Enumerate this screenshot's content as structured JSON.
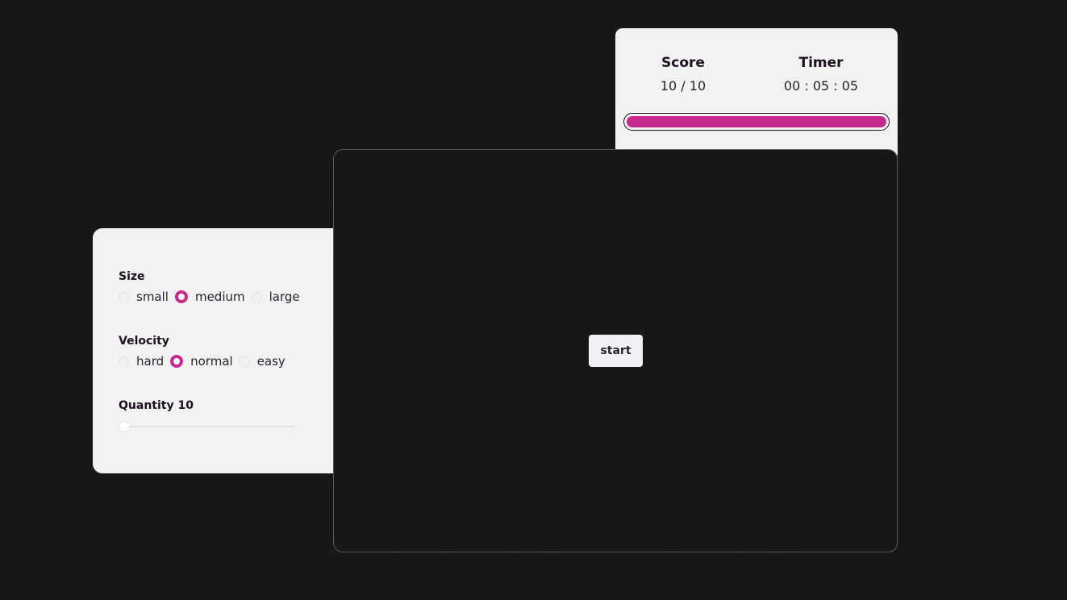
{
  "score_panel": {
    "score_label": "Score",
    "score_value": "10 / 10",
    "timer_label": "Timer",
    "timer_value": "00 : 05 : 05",
    "progress_fraction": 1.0
  },
  "settings": {
    "size": {
      "title": "Size",
      "options": [
        "small",
        "medium",
        "large"
      ],
      "selected": "medium"
    },
    "velocity": {
      "title": "Velocity",
      "options": [
        "hard",
        "normal",
        "easy"
      ],
      "selected": "normal"
    },
    "quantity": {
      "title": "Quantity 10",
      "value": 10,
      "min": 10,
      "max": 100
    }
  },
  "board": {
    "start_label": "start"
  },
  "colors": {
    "accent": "#c52a8c",
    "panel": "#f3f3f4",
    "background": "#161616",
    "text_dark": "#1d0f1f"
  }
}
